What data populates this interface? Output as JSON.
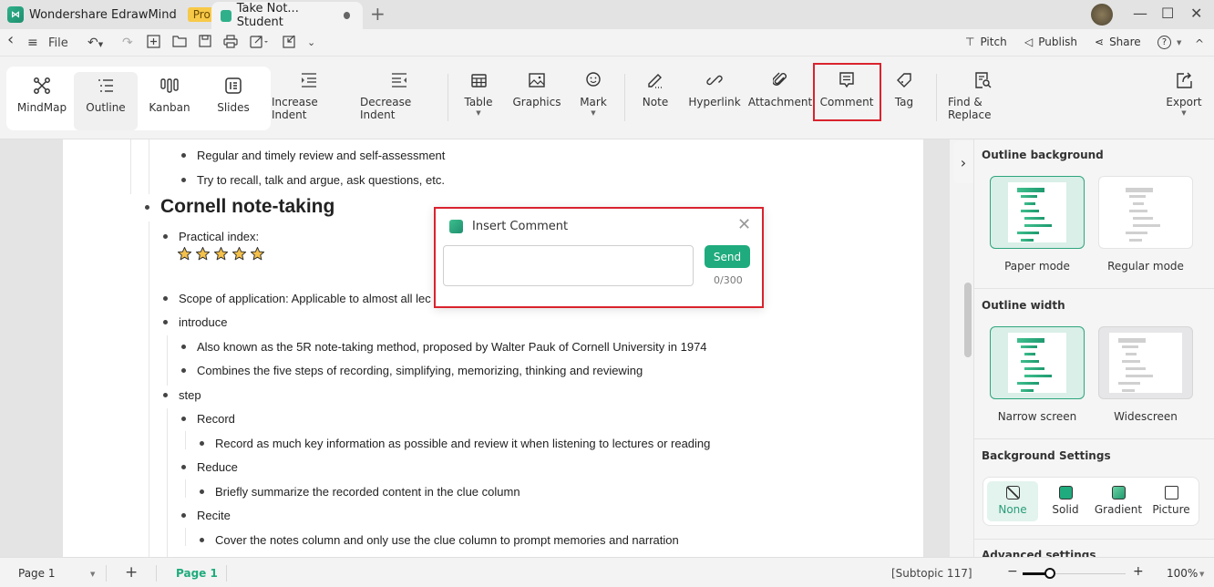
{
  "titlebar": {
    "app_name": "Wondershare EdrawMind",
    "pro_badge": "Pro",
    "doc_tab_title": "Take Not... Student",
    "new_tab": "+",
    "window_controls": {
      "minimize": "—",
      "maximize": "☐",
      "close": "✕"
    }
  },
  "quickbar": {
    "back": "‹",
    "menu": "≡",
    "file_label": "File",
    "right": {
      "pitch": "Pitch",
      "publish": "Publish",
      "share": "Share",
      "help": "?",
      "collapse": "^"
    }
  },
  "ribbon": {
    "views": [
      {
        "label": "MindMap",
        "icon": "mindmap-icon",
        "selected": false
      },
      {
        "label": "Outline",
        "icon": "outline-icon",
        "selected": true
      },
      {
        "label": "Kanban",
        "icon": "kanban-icon",
        "selected": false
      },
      {
        "label": "Slides",
        "icon": "slides-icon",
        "selected": false
      }
    ],
    "tools": {
      "increase_indent": "Increase Indent",
      "decrease_indent": "Decrease Indent",
      "table": "Table",
      "graphics": "Graphics",
      "mark": "Mark",
      "note": "Note",
      "hyperlink": "Hyperlink",
      "attachment": "Attachment",
      "comment": "Comment",
      "tag": "Tag",
      "find_replace": "Find & Replace",
      "export": "Export"
    }
  },
  "outline": {
    "items": [
      {
        "level": 2,
        "text": "Regular and timely review and self-assessment"
      },
      {
        "level": 2,
        "text": "Try to recall, talk and argue, ask questions, etc."
      },
      {
        "level": 0,
        "text": "Cornell note-taking"
      },
      {
        "level": 1,
        "text": "Practical index:"
      },
      {
        "level": 1,
        "text": "Scope of application: Applicable to almost all lec"
      },
      {
        "level": 1,
        "text": "introduce"
      },
      {
        "level": 2,
        "text": "Also known as the 5R note-taking method, proposed by Walter Pauk of Cornell University in 1974"
      },
      {
        "level": 2,
        "text": "Combines the five steps of recording, simplifying, memorizing, thinking and reviewing"
      },
      {
        "level": 1,
        "text": "step"
      },
      {
        "level": 2,
        "text": "Record"
      },
      {
        "level": 3,
        "text": "Record as much key information as possible and review it when listening to lectures or reading"
      },
      {
        "level": 2,
        "text": "Reduce"
      },
      {
        "level": 3,
        "text": "Briefly summarize the recorded content in the clue column"
      },
      {
        "level": 2,
        "text": "Recite"
      },
      {
        "level": 3,
        "text": "Cover the notes column and only use the clue column to prompt memories and narration"
      }
    ],
    "practical_index_rating": 5,
    "rating_max": 5
  },
  "dialog": {
    "title": "Insert Comment",
    "input_value": "",
    "input_placeholder": "",
    "send_label": "Send",
    "char_count": "0/300",
    "close": "✕"
  },
  "panel": {
    "outline_background": {
      "title": "Outline background",
      "options": [
        {
          "label": "Paper mode",
          "selected": true
        },
        {
          "label": "Regular mode",
          "selected": false
        }
      ]
    },
    "outline_width": {
      "title": "Outline width",
      "options": [
        {
          "label": "Narrow screen",
          "selected": true
        },
        {
          "label": "Widescreen",
          "selected": false
        }
      ]
    },
    "background_settings": {
      "title": "Background Settings",
      "options": [
        {
          "label": "None",
          "selected": true
        },
        {
          "label": "Solid",
          "selected": false
        },
        {
          "label": "Gradient",
          "selected": false
        },
        {
          "label": "Picture",
          "selected": false
        }
      ]
    },
    "advanced_settings": "Advanced settings"
  },
  "statusbar": {
    "page_select": "Page 1",
    "add_page": "+",
    "active_page_tab": "Page 1",
    "selection": "[Subtopic 117]",
    "zoom_minus": "−",
    "zoom_plus": "+",
    "zoom_level": "100%",
    "zoom_slider_fraction": 0.33
  },
  "colors": {
    "accent": "#1fab7d",
    "highlight": "#d9232e",
    "pro_badge": "#f7c948"
  }
}
